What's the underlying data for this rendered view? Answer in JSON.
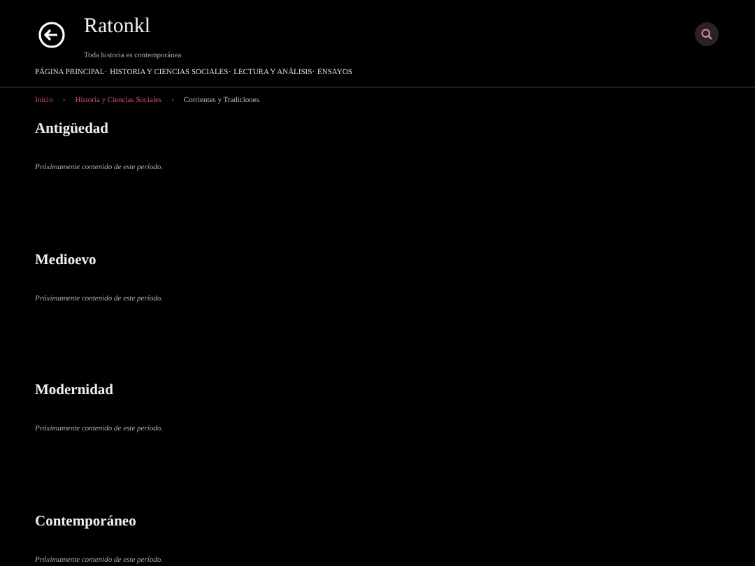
{
  "header": {
    "title": "Ratonkl",
    "subtitle": "Toda historia es contemporánea",
    "nav_separator": "·",
    "nav": [
      {
        "label": "PÁGINA PRINCIPAL"
      },
      {
        "label": "HISTORIA Y CIENCIAS SOCIALES"
      },
      {
        "label": "LECTURA Y ANÁLISIS"
      },
      {
        "label": "ENSAYOS"
      }
    ]
  },
  "breadcrumb": {
    "separator": "›",
    "items": [
      {
        "label": "Inicio",
        "kind": "link"
      },
      {
        "label": "Historia y Ciencias Sociales",
        "kind": "link"
      },
      {
        "label": "Corrientes y Tradiciones",
        "kind": "current"
      }
    ]
  },
  "sections": [
    {
      "heading": "Antigüedad",
      "text": "Próximamente contenido de este período."
    },
    {
      "heading": "Medioevo",
      "text": "Próximamente contenido de este período."
    },
    {
      "heading": "Modernidad",
      "text": "Próximamente contenido de este período."
    },
    {
      "heading": "Contemporáneo",
      "text": "Próximamente contenido de este período."
    }
  ]
}
